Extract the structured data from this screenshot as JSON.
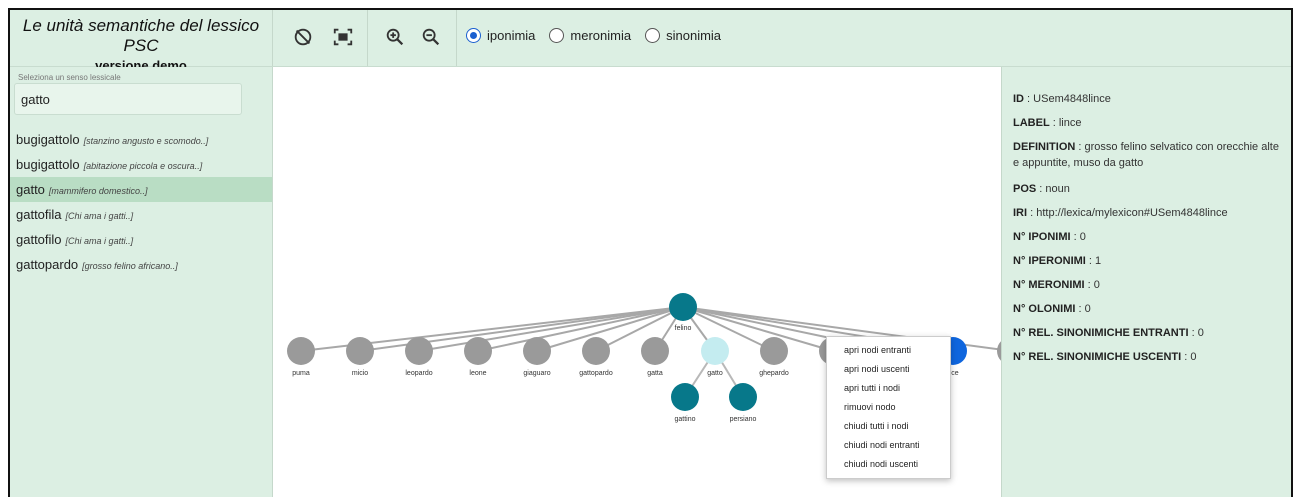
{
  "header": {
    "title": "Le unità semantiche del lessico PSC",
    "subtitle": "versione demo",
    "tools": [
      {
        "name": "reset-icon"
      },
      {
        "name": "fit-screen-icon"
      },
      {
        "name": "zoom-in-icon"
      },
      {
        "name": "zoom-out-icon"
      }
    ],
    "relations": [
      {
        "label": "iponimia",
        "selected": true
      },
      {
        "label": "meronimia",
        "selected": false
      },
      {
        "label": "sinonimia",
        "selected": false
      }
    ]
  },
  "search": {
    "label": "Seleziona un senso lessicale",
    "value": "gatto"
  },
  "senses": [
    {
      "lemma": "bugigattolo",
      "gloss": "[stanzino angusto e scomodo..]",
      "selected": false
    },
    {
      "lemma": "bugigattolo",
      "gloss": "[abitazione piccola e oscura..]",
      "selected": false
    },
    {
      "lemma": "gatto",
      "gloss": "[mammifero domestico..]",
      "selected": true
    },
    {
      "lemma": "gattofila",
      "gloss": "[Chi ama i gatti..]",
      "selected": false
    },
    {
      "lemma": "gattofilo",
      "gloss": "[Chi ama i gatti..]",
      "selected": false
    },
    {
      "lemma": "gattopardo",
      "gloss": "[grosso felino africano..]",
      "selected": false
    }
  ],
  "graph": {
    "root": {
      "label": "felino"
    },
    "children": [
      {
        "label": "puma",
        "state": "grey"
      },
      {
        "label": "micio",
        "state": "grey"
      },
      {
        "label": "leopardo",
        "state": "grey"
      },
      {
        "label": "leone",
        "state": "grey"
      },
      {
        "label": "giaguaro",
        "state": "grey"
      },
      {
        "label": "gattopardo",
        "state": "grey"
      },
      {
        "label": "gatta",
        "state": "grey"
      },
      {
        "label": "gatto",
        "state": "light"
      },
      {
        "label": "ghepardo",
        "state": "grey"
      },
      {
        "label": "le",
        "state": "grey"
      },
      {
        "label": "",
        "state": "grey"
      },
      {
        "label": "nce",
        "state": "selected"
      },
      {
        "label": "",
        "state": "grey"
      }
    ],
    "sub_children": [
      {
        "label": "gattino"
      },
      {
        "label": "persiano"
      }
    ],
    "colors": {
      "dark": "#07788a",
      "light": "#c4ecf0",
      "grey": "#9a9a9a",
      "selected": "#0f66de"
    }
  },
  "context_menu": [
    "apri nodi entranti",
    "apri nodi uscenti",
    "apri tutti i nodi",
    "rimuovi nodo",
    "chiudi tutti i nodi",
    "chiudi nodi entranti",
    "chiudi nodi uscenti"
  ],
  "details": [
    {
      "key": "ID",
      "value": "USem4848lince"
    },
    {
      "key": "LABEL",
      "value": "lince"
    },
    {
      "key": "DEFINITION",
      "value": "grosso felino selvatico con orecchie alte e appuntite, muso da gatto"
    },
    {
      "key": "POS",
      "value": "noun"
    },
    {
      "key": "IRI",
      "value": "http://lexica/mylexicon#USem4848lince"
    },
    {
      "key": "N° IPONIMI",
      "value": "0"
    },
    {
      "key": "N° IPERONIMI",
      "value": "1"
    },
    {
      "key": "N° MERONIMI",
      "value": "0"
    },
    {
      "key": "N° OLONIMI",
      "value": "0"
    },
    {
      "key": "N° REL. SINONIMICHE ENTRANTI",
      "value": "0"
    },
    {
      "key": "N° REL. SINONIMICHE USCENTI",
      "value": "0"
    }
  ]
}
